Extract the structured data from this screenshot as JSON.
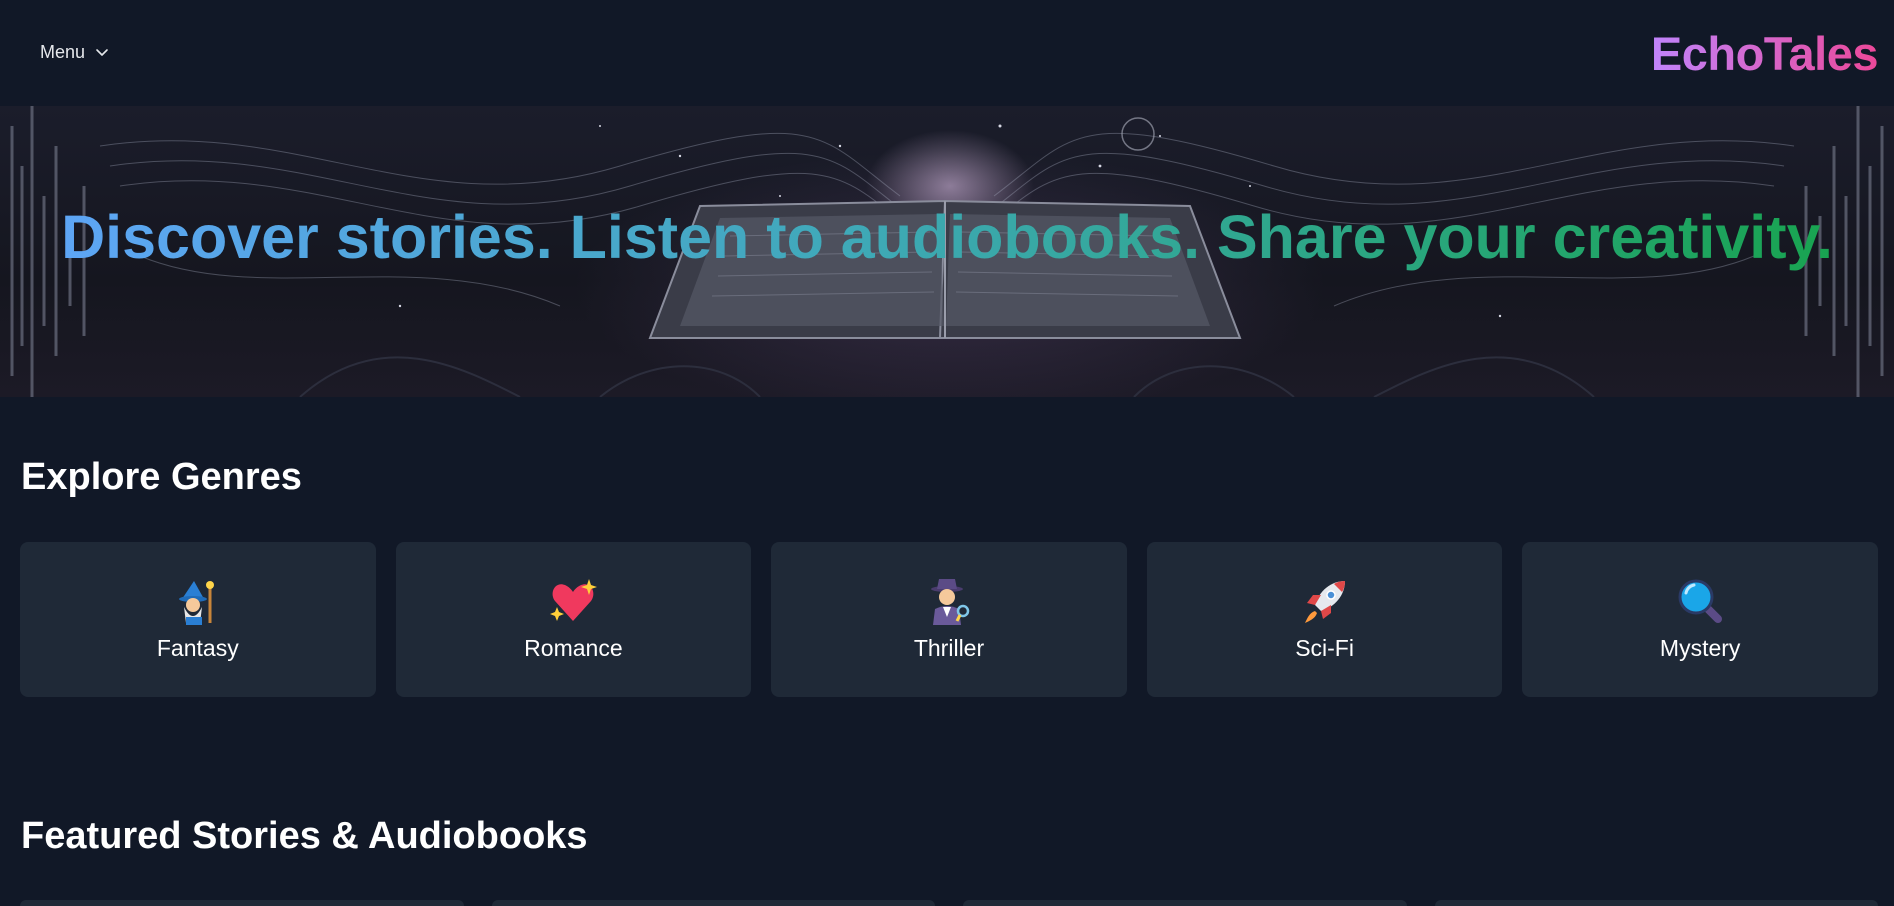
{
  "header": {
    "menu_label": "Menu",
    "logo": "EchoTales"
  },
  "hero": {
    "headline": "Discover stories. Listen to audiobooks. Share your creativity."
  },
  "genres": {
    "title": "Explore Genres",
    "items": [
      {
        "label": "Fantasy",
        "icon": "wizard-icon"
      },
      {
        "label": "Romance",
        "icon": "sparkling-heart-icon"
      },
      {
        "label": "Thriller",
        "icon": "detective-icon"
      },
      {
        "label": "Sci-Fi",
        "icon": "rocket-icon"
      },
      {
        "label": "Mystery",
        "icon": "magnifying-glass-icon"
      }
    ]
  },
  "featured": {
    "title": "Featured Stories & Audiobooks"
  },
  "colors": {
    "background": "#111827",
    "card": "#1f2937",
    "logo_gradient": [
      "#c084fc",
      "#ec4899"
    ],
    "headline_gradient": [
      "#60a5fa",
      "#16a34a"
    ]
  }
}
